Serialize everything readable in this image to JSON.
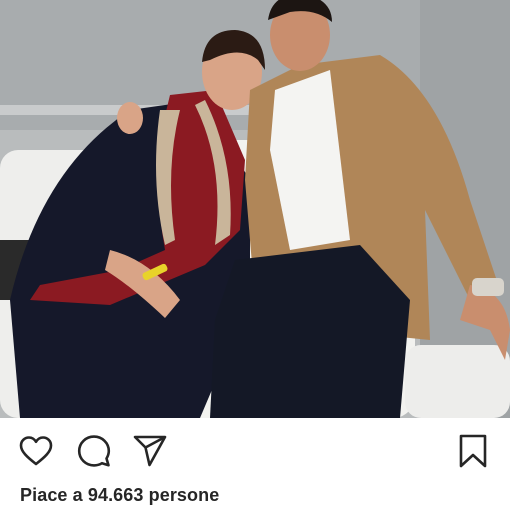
{
  "post": {
    "photo": {
      "subject": "post-photo"
    },
    "actions": {
      "like_icon": "heart-icon",
      "comment_icon": "comment-icon",
      "share_icon": "send-icon",
      "save_icon": "bookmark-icon"
    },
    "likes_text": "Piace a 94.663 persone"
  },
  "colors": {
    "icon": "#262626",
    "text": "#262626",
    "background": "#ffffff"
  }
}
